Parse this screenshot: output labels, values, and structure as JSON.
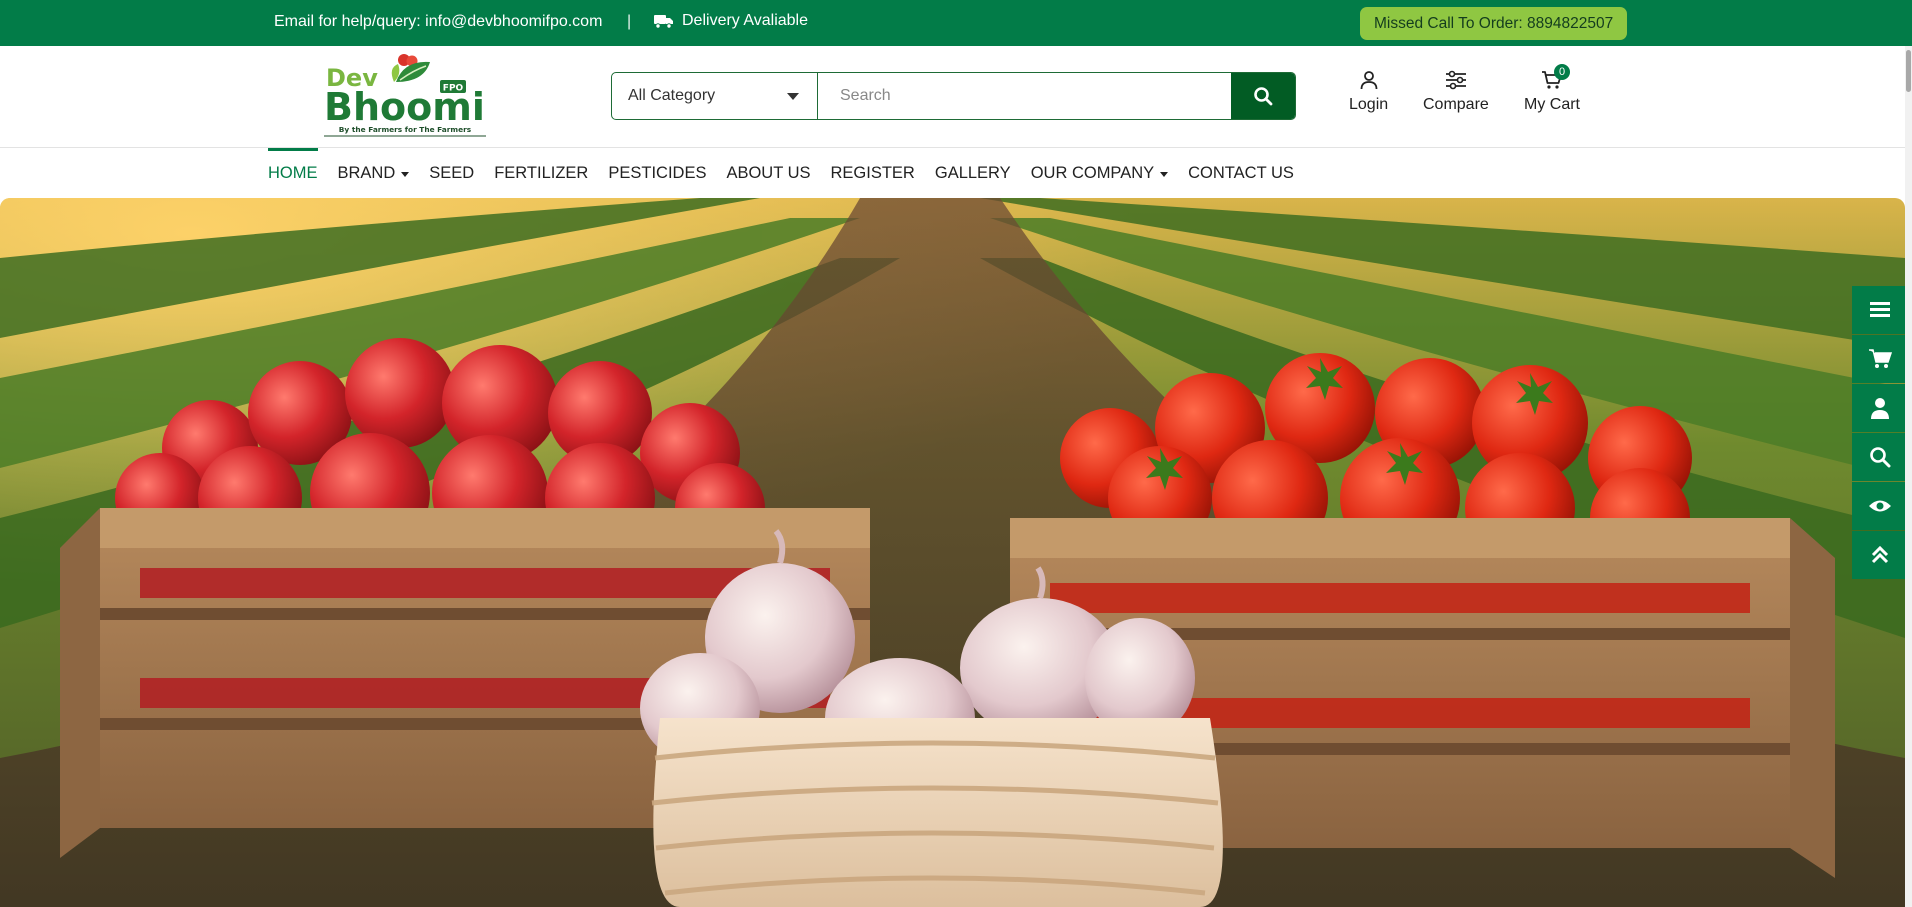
{
  "topbar": {
    "email_text": "Email for help/query: info@devbhoomifpo.com",
    "separator": "|",
    "delivery_text": "Delivery Avaliable",
    "missed_call_text": "Missed Call To Order: 8894822507"
  },
  "logo": {
    "line1": "Dev",
    "line2": "Bhoomi",
    "badge": "FPO",
    "tagline": "By the Farmers for The Farmers"
  },
  "search": {
    "category_label": "All Category",
    "placeholder": "Search",
    "value": ""
  },
  "header_actions": {
    "login_label": "Login",
    "compare_label": "Compare",
    "cart_label": "My Cart",
    "cart_count": "0"
  },
  "nav": {
    "home": "HOME",
    "brand": "BRAND",
    "seed": "SEED",
    "fertilizer": "FERTILIZER",
    "pesticides": "PESTICIDES",
    "about": "ABOUT US",
    "register": "REGISTER",
    "gallery": "GALLERY",
    "company": "OUR COMPANY",
    "contact": "CONTACT US"
  },
  "colors": {
    "brand_green": "#027c48",
    "dark_green": "#025c24",
    "light_green": "#8fc742"
  },
  "sidebar_icons": [
    "list-icon",
    "cart-icon",
    "user-icon",
    "search-icon",
    "eye-icon",
    "chevrons-up-icon"
  ]
}
